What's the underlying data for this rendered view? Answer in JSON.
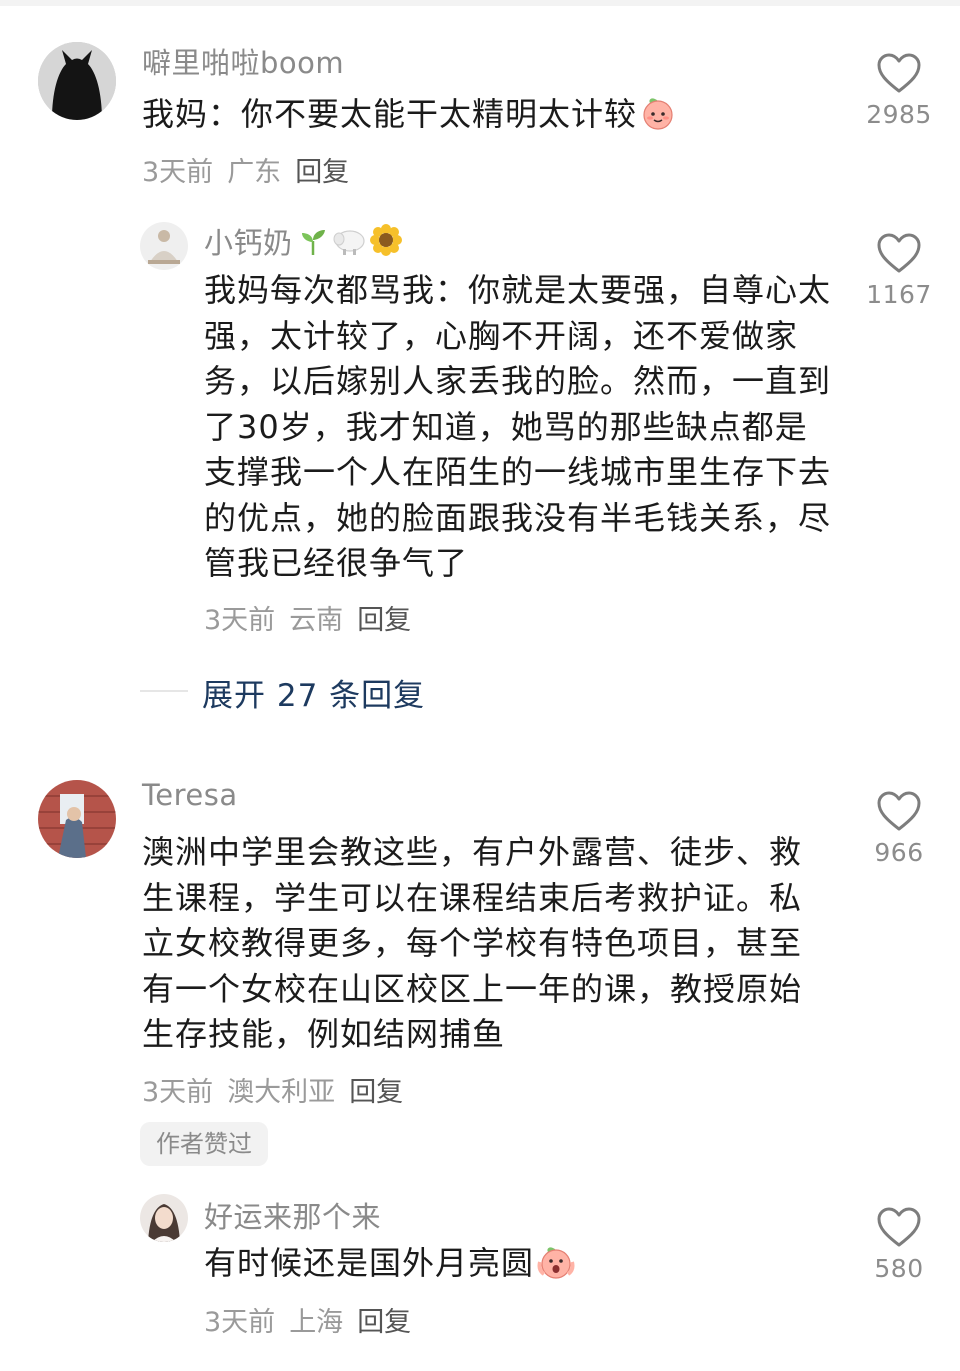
{
  "comments": [
    {
      "username": "噼里啪啦boom",
      "text": "我妈：你不要太能干太精明太计较",
      "time": "3天前",
      "location": "广东",
      "reply_label": "回复",
      "likes": "2985",
      "emoji": "peach-face"
    },
    {
      "username": "小钙奶",
      "text": "我妈每次都骂我：你就是太要强，自尊心太强，太计较了，心胸不开阔，还不爱做家务，以后嫁别人家丢我的脸。然而，一直到了30岁，我才知道，她骂的那些缺点都是支撑我一个人在陌生的一线城市里生存下去的优点，她的脸面跟我没有半毛钱关系，尽管我已经很争气了",
      "time": "3天前",
      "location": "云南",
      "reply_label": "回复",
      "likes": "1167"
    },
    {
      "username": "Teresa",
      "text": "澳洲中学里会教这些，有户外露营、徒步、救生课程，学生可以在课程结束后考救护证。私立女校教得更多，每个学校有特色项目，甚至有一个女校在山区校区上一年的课，教授原始生存技能，例如结网捕鱼",
      "time": "3天前",
      "location": "澳大利亚",
      "reply_label": "回复",
      "likes": "966",
      "badge": "作者赞过"
    },
    {
      "username": "好运来那个来",
      "text": "有时候还是国外月亮圆",
      "time": "3天前",
      "location": "上海",
      "reply_label": "回复",
      "likes": "580",
      "emoji": "peach-face-shocked"
    }
  ],
  "expand_replies": "展开 27 条回复",
  "icons": {
    "like": "heart-outline-icon",
    "username_decor": [
      "seedling-icon",
      "sheep-icon",
      "sunflower-icon"
    ]
  },
  "colors": {
    "text": "#1b1b1b",
    "meta": "#9a9a9a",
    "expand": "#1d3a5f",
    "heart": "#7d7d7d"
  }
}
